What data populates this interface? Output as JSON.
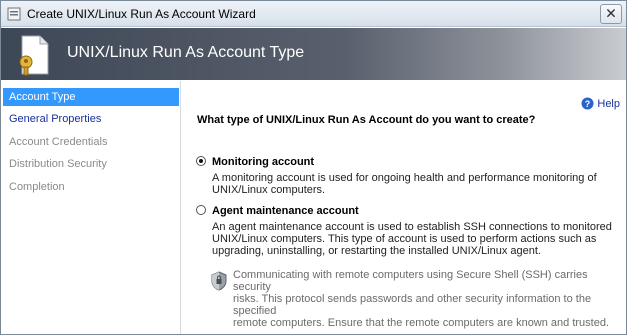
{
  "window": {
    "title": "Create UNIX/Linux Run As Account Wizard"
  },
  "header": {
    "title": "UNIX/Linux Run As Account Type"
  },
  "nav": {
    "items": [
      {
        "label": "Account Type"
      },
      {
        "label": "General Properties"
      },
      {
        "label": "Account Credentials"
      },
      {
        "label": "Distribution Security"
      },
      {
        "label": "Completion"
      }
    ]
  },
  "help": {
    "label": "Help"
  },
  "main": {
    "question": "What type of UNIX/Linux Run As Account do you want to create?",
    "options": [
      {
        "label": "Monitoring account",
        "selected": true,
        "description_lines": [
          "A monitoring account is used for ongoing health and performance monitoring of",
          "UNIX/Linux computers."
        ]
      },
      {
        "label": "Agent maintenance account",
        "selected": false,
        "description_lines": [
          "An agent maintenance account is used to establish SSH connections to monitored",
          "UNIX/Linux computers. This type of account is used to perform actions such as",
          "upgrading, uninstalling, or restarting the installed UNIX/Linux agent."
        ]
      }
    ],
    "security_note_lines": [
      "Communicating with remote computers using Secure Shell (SSH) carries security",
      "risks. This protocol sends passwords and other security information to the specified",
      "remote computers. Ensure that the remote computers are known and trusted."
    ]
  },
  "colors": {
    "nav_selected": "#3399ff",
    "link": "#1b2f9a",
    "banner_dark": "#3e4756"
  },
  "icons": [
    "wizard-app-icon",
    "document-key-icon",
    "help-icon",
    "shield-icon",
    "close-icon"
  ]
}
